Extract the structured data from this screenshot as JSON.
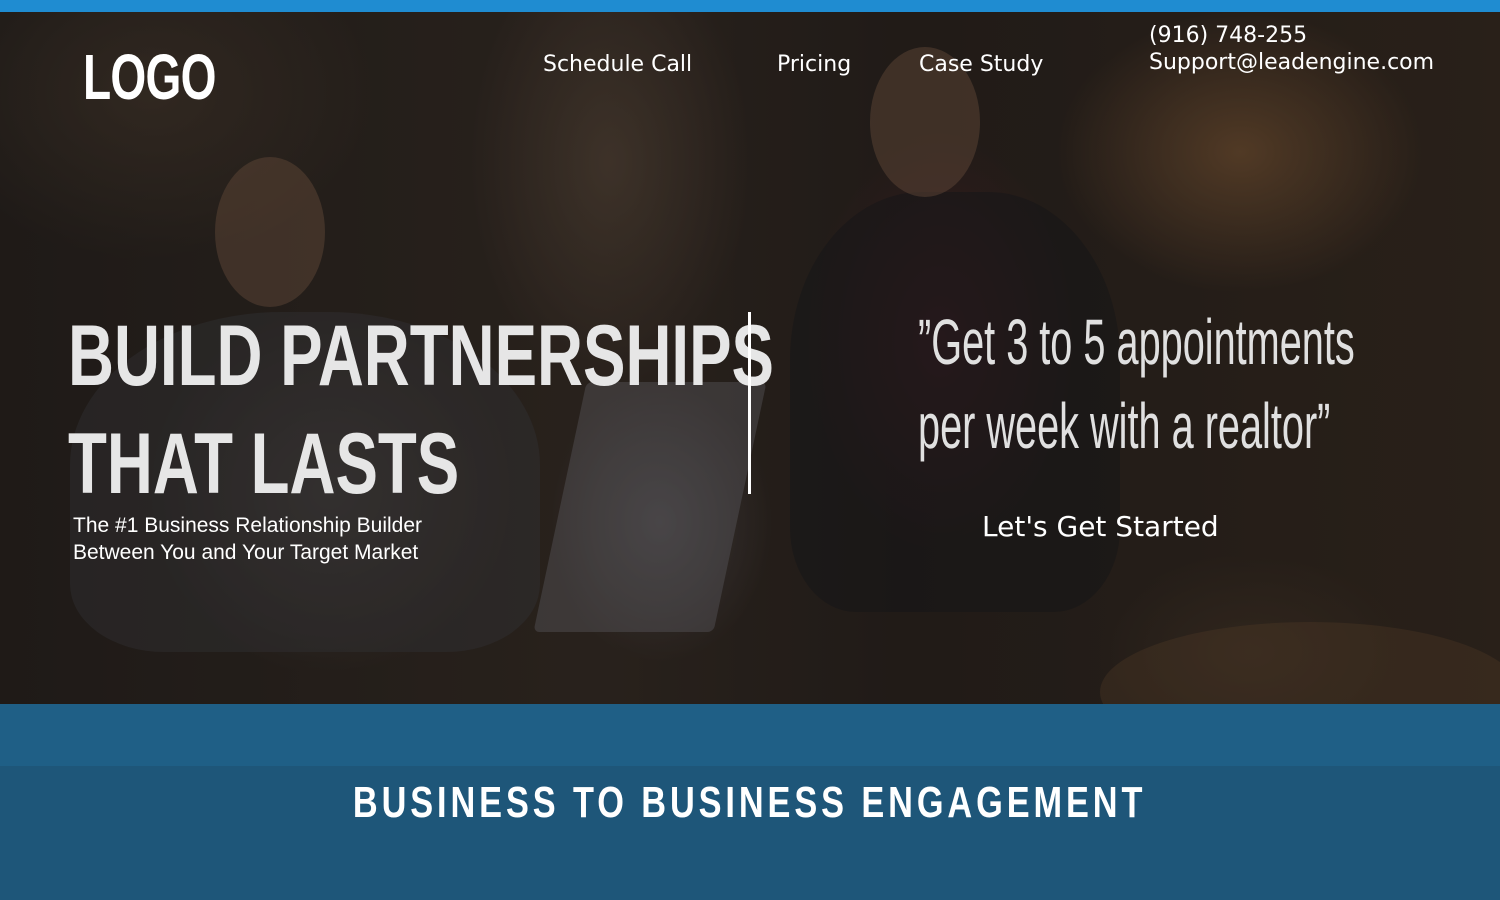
{
  "header": {
    "logo": "LOGO",
    "nav": [
      {
        "label": "Schedule Call"
      },
      {
        "label": "Pricing"
      },
      {
        "label": "Case Study"
      }
    ],
    "contact": {
      "phone": "(916) 748-255",
      "email": "Support@leadengine.com"
    }
  },
  "hero": {
    "headline_line1": "BUILD PARTNERSHIPS",
    "headline_line2": "THAT LASTS",
    "subhead_line1": "The #1 Business Relationship Builder",
    "subhead_line2": "Between You and Your Target Market",
    "quote_line1": "”Get 3 to 5 appointments",
    "quote_line2": "per week with a realtor”",
    "cta_label": "Let's Get Started"
  },
  "section": {
    "title": "BUSINESS TO BUSINESS ENGAGEMENT"
  },
  "colors": {
    "top_strip": "#1f8cd1",
    "band": "#1e5679"
  }
}
